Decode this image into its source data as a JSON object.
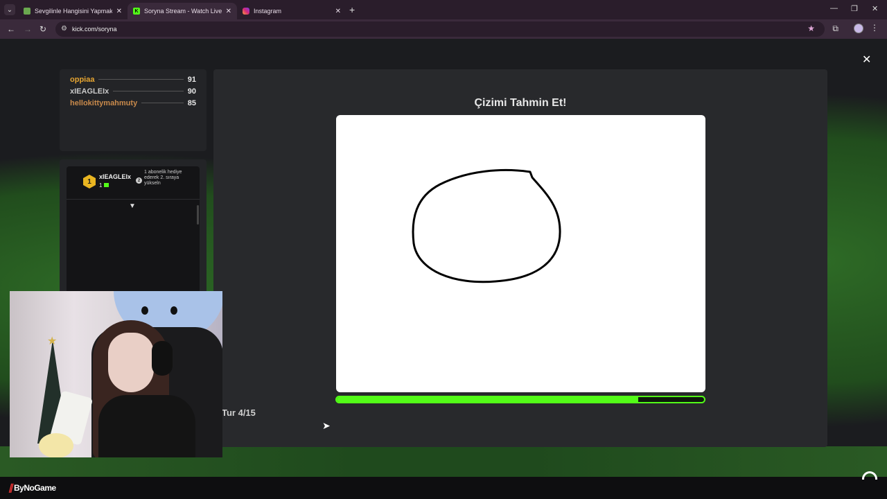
{
  "browser": {
    "tabs": [
      {
        "title": "Sevgilinle Hangisini Yapmak İste",
        "active": false
      },
      {
        "title": "Soryna Stream - Watch Live on",
        "active": true
      },
      {
        "title": "Instagram",
        "active": false
      }
    ],
    "url": "kick.com/soryna"
  },
  "leaderboard": [
    {
      "name": "oppiaa",
      "score": "91",
      "color": "#e6a531"
    },
    {
      "name": "xIEAGLEIx",
      "score": "90",
      "color": "#c9c9c9"
    },
    {
      "name": "hellokittymahmuty",
      "score": "85",
      "color": "#c98a4b"
    }
  ],
  "sub_goal": {
    "rank": "1",
    "user": "xIEAGLEIx",
    "count": "1",
    "hint_icon_label": "2",
    "hint": "1 abonelik hediye ederek 2. sıraya yükseln"
  },
  "game": {
    "title": "Çizimi Tahmin Et!",
    "round": "Tur 4/15",
    "timer_progress": 0.82
  },
  "footer": {
    "brand": "ByNoGame"
  },
  "colors": {
    "kick_green": "#53fc18",
    "gold": "#e9b521"
  }
}
